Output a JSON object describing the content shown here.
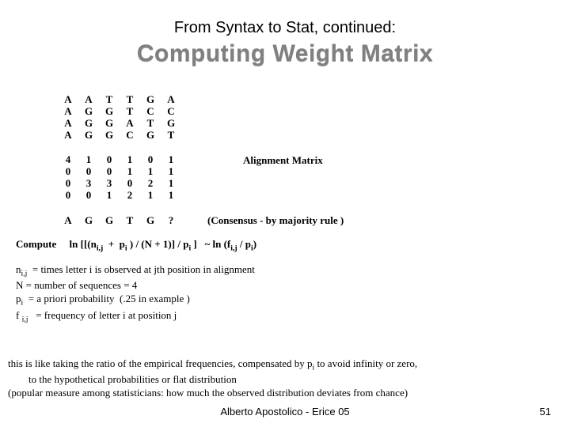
{
  "header": {
    "pretitle": "From Syntax to Stat, continued:",
    "title": "Computing Weight Matrix"
  },
  "sequence_matrix": {
    "columns": [
      [
        "A",
        "A",
        "A",
        "A"
      ],
      [
        "A",
        "G",
        "G",
        "G"
      ],
      [
        "T",
        "G",
        "G",
        "G"
      ],
      [
        "T",
        "T",
        "A",
        "C"
      ],
      [
        "G",
        "C",
        "T",
        "G"
      ],
      [
        "A",
        "C",
        "G",
        "T"
      ]
    ]
  },
  "alignment_matrix": {
    "columns": [
      [
        "4",
        "0",
        "0",
        "0"
      ],
      [
        "1",
        "0",
        "3",
        "0"
      ],
      [
        "0",
        "0",
        "3",
        "1"
      ],
      [
        "1",
        "1",
        "0",
        "2"
      ],
      [
        "0",
        "1",
        "2",
        "1"
      ],
      [
        "1",
        "1",
        "1",
        "1"
      ]
    ],
    "label": "Alignment Matrix"
  },
  "consensus": {
    "row": [
      "A",
      "G",
      "G",
      "T",
      "G",
      "?"
    ],
    "label": "(Consensus - by majority rule )"
  },
  "formula": {
    "prefix": "Compute",
    "body": "ln [[(n_{i,j}  +  p_i ) / (N + 1)] / p_i ]   ~ ln (f_{i,j} / p_i)"
  },
  "definitions": {
    "n": "n_{i,j}  = times letter i is observed at jth position in alignment",
    "N": "N = number of sequences = 4",
    "p": "p_i  = a priori probability  (.25 in example )",
    "f": "f_{i,j}  = frequency of letter i at position j"
  },
  "explanation": "this is like taking the ratio of the empirical frequencies, compensated by p_i to avoid infinity or zero, to the hypothetical probabilities or flat distribution\n(popular measure among statisticians: how much the observed distribution deviates from chance)",
  "footer": {
    "author": "Alberto Apostolico  - Erice 05",
    "page": "51"
  }
}
